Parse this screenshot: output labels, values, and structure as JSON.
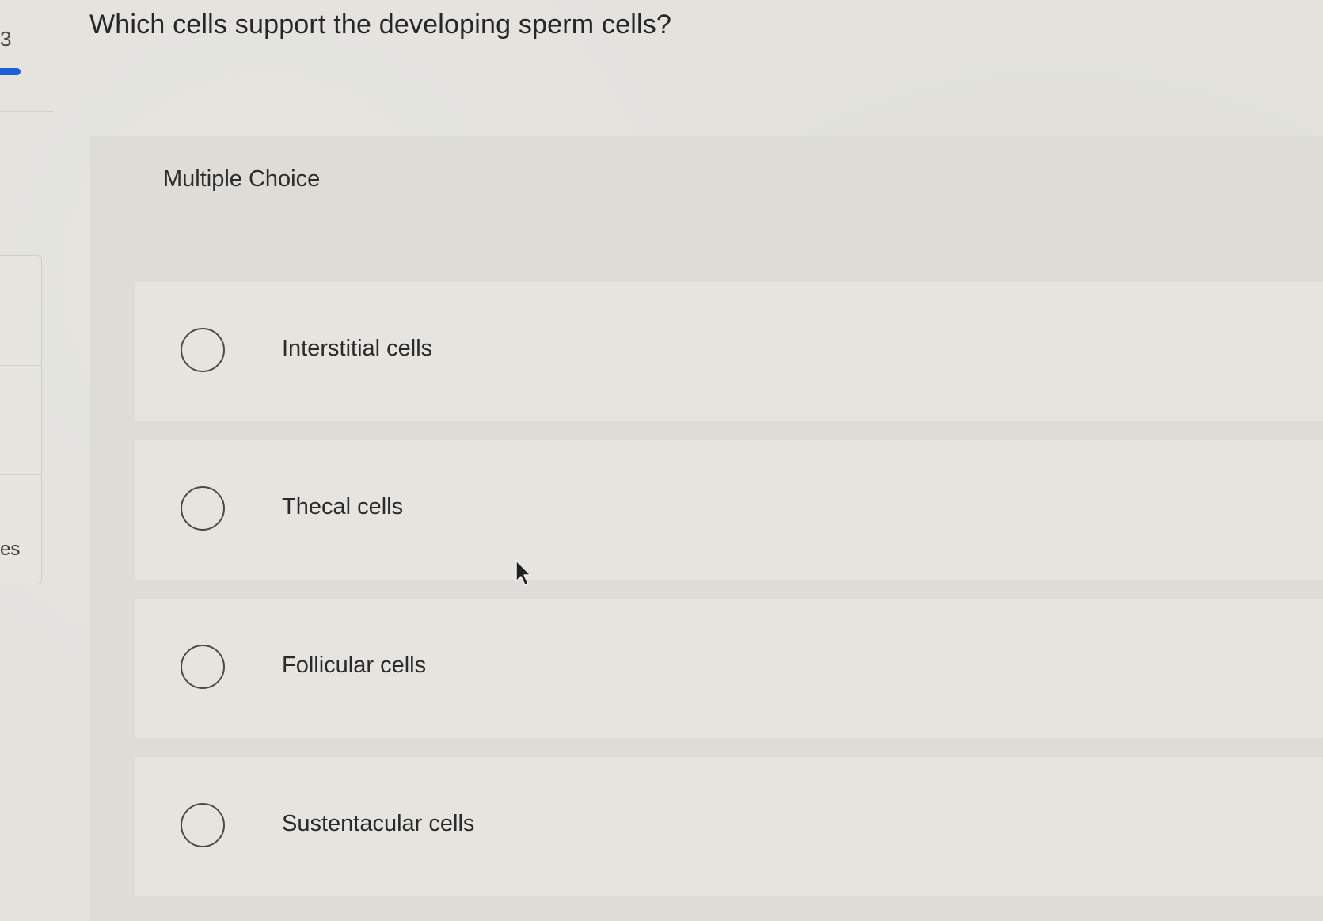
{
  "sidebar": {
    "question_number": "3",
    "partial_label": "es"
  },
  "question": {
    "prompt": "Which cells support the developing sperm cells?",
    "type_label": "Multiple Choice",
    "options": [
      {
        "label": "Interstitial cells",
        "selected": false
      },
      {
        "label": "Thecal cells",
        "selected": false
      },
      {
        "label": "Follicular cells",
        "selected": false
      },
      {
        "label": "Sustentacular cells",
        "selected": false
      }
    ]
  },
  "colors": {
    "progress_accent": "#1f5fd6",
    "background": "#e3e2dd",
    "card": "#dddcd7",
    "option_row": "#e5e4df"
  },
  "icons": {
    "cursor": "mouse-pointer-icon",
    "radio": "radio-empty-icon"
  }
}
